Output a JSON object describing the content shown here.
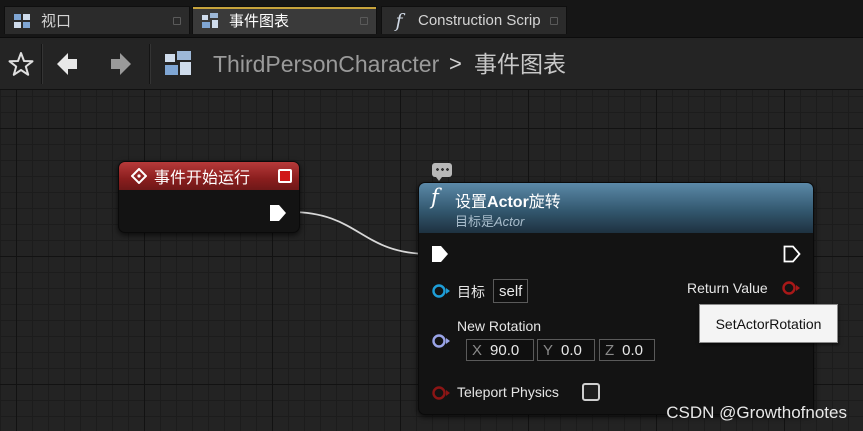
{
  "tabs": [
    {
      "label": "视口",
      "icon": "viewport-grid-icon",
      "active": false
    },
    {
      "label": "事件图表",
      "icon": "event-graph-icon",
      "active": true
    },
    {
      "label": "Construction Scrip",
      "icon": "function-f-icon",
      "active": false
    }
  ],
  "breadcrumb": {
    "root": "ThirdPersonCharacter",
    "separator": ">",
    "current": "事件图表"
  },
  "event_node": {
    "title": "事件开始运行",
    "header_color": "#9e2626"
  },
  "function_node": {
    "icon": "f",
    "title_prefix": "设置",
    "title_bold": "Actor",
    "title_suffix": "旋转",
    "subtitle_prefix": "目标是",
    "subtitle_italic": "Actor",
    "header_color": "#3f6a86",
    "pins": {
      "target_label": "目标",
      "target_value": "self",
      "rotation_label": "New Rotation",
      "rotation": [
        {
          "axis": "X",
          "value": "90.0"
        },
        {
          "axis": "Y",
          "value": "0.0"
        },
        {
          "axis": "Z",
          "value": "0.0"
        }
      ],
      "teleport_label": "Teleport Physics",
      "teleport_checked": false,
      "return_label": "Return Value"
    }
  },
  "tooltip": "SetActorRotation",
  "watermark": "CSDN @Growthofnotes",
  "colors": {
    "object_pin": "#1e9ed8",
    "rotator_pin": "#9aa4e8",
    "bool_pin": "#8c1515",
    "exec_pin": "#ffffff"
  }
}
